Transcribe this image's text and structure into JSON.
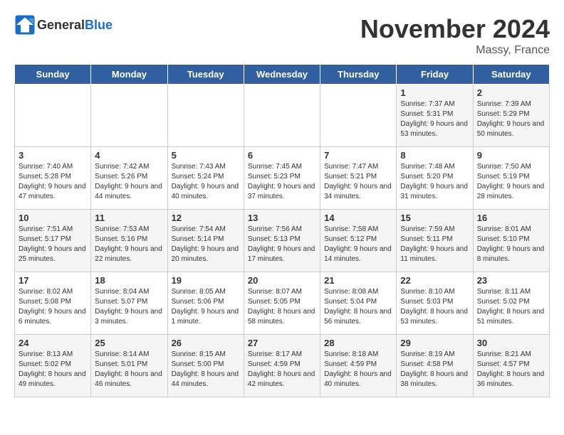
{
  "header": {
    "logo_general": "General",
    "logo_blue": "Blue",
    "title": "November 2024",
    "location": "Massy, France"
  },
  "days_of_week": [
    "Sunday",
    "Monday",
    "Tuesday",
    "Wednesday",
    "Thursday",
    "Friday",
    "Saturday"
  ],
  "weeks": [
    [
      {
        "day": "",
        "info": ""
      },
      {
        "day": "",
        "info": ""
      },
      {
        "day": "",
        "info": ""
      },
      {
        "day": "",
        "info": ""
      },
      {
        "day": "",
        "info": ""
      },
      {
        "day": "1",
        "info": "Sunrise: 7:37 AM\nSunset: 5:31 PM\nDaylight: 9 hours and 53 minutes."
      },
      {
        "day": "2",
        "info": "Sunrise: 7:39 AM\nSunset: 5:29 PM\nDaylight: 9 hours and 50 minutes."
      }
    ],
    [
      {
        "day": "3",
        "info": "Sunrise: 7:40 AM\nSunset: 5:28 PM\nDaylight: 9 hours and 47 minutes."
      },
      {
        "day": "4",
        "info": "Sunrise: 7:42 AM\nSunset: 5:26 PM\nDaylight: 9 hours and 44 minutes."
      },
      {
        "day": "5",
        "info": "Sunrise: 7:43 AM\nSunset: 5:24 PM\nDaylight: 9 hours and 40 minutes."
      },
      {
        "day": "6",
        "info": "Sunrise: 7:45 AM\nSunset: 5:23 PM\nDaylight: 9 hours and 37 minutes."
      },
      {
        "day": "7",
        "info": "Sunrise: 7:47 AM\nSunset: 5:21 PM\nDaylight: 9 hours and 34 minutes."
      },
      {
        "day": "8",
        "info": "Sunrise: 7:48 AM\nSunset: 5:20 PM\nDaylight: 9 hours and 31 minutes."
      },
      {
        "day": "9",
        "info": "Sunrise: 7:50 AM\nSunset: 5:19 PM\nDaylight: 9 hours and 28 minutes."
      }
    ],
    [
      {
        "day": "10",
        "info": "Sunrise: 7:51 AM\nSunset: 5:17 PM\nDaylight: 9 hours and 25 minutes."
      },
      {
        "day": "11",
        "info": "Sunrise: 7:53 AM\nSunset: 5:16 PM\nDaylight: 9 hours and 22 minutes."
      },
      {
        "day": "12",
        "info": "Sunrise: 7:54 AM\nSunset: 5:14 PM\nDaylight: 9 hours and 20 minutes."
      },
      {
        "day": "13",
        "info": "Sunrise: 7:56 AM\nSunset: 5:13 PM\nDaylight: 9 hours and 17 minutes."
      },
      {
        "day": "14",
        "info": "Sunrise: 7:58 AM\nSunset: 5:12 PM\nDaylight: 9 hours and 14 minutes."
      },
      {
        "day": "15",
        "info": "Sunrise: 7:59 AM\nSunset: 5:11 PM\nDaylight: 9 hours and 11 minutes."
      },
      {
        "day": "16",
        "info": "Sunrise: 8:01 AM\nSunset: 5:10 PM\nDaylight: 9 hours and 8 minutes."
      }
    ],
    [
      {
        "day": "17",
        "info": "Sunrise: 8:02 AM\nSunset: 5:08 PM\nDaylight: 9 hours and 6 minutes."
      },
      {
        "day": "18",
        "info": "Sunrise: 8:04 AM\nSunset: 5:07 PM\nDaylight: 9 hours and 3 minutes."
      },
      {
        "day": "19",
        "info": "Sunrise: 8:05 AM\nSunset: 5:06 PM\nDaylight: 9 hours and 1 minute."
      },
      {
        "day": "20",
        "info": "Sunrise: 8:07 AM\nSunset: 5:05 PM\nDaylight: 8 hours and 58 minutes."
      },
      {
        "day": "21",
        "info": "Sunrise: 8:08 AM\nSunset: 5:04 PM\nDaylight: 8 hours and 56 minutes."
      },
      {
        "day": "22",
        "info": "Sunrise: 8:10 AM\nSunset: 5:03 PM\nDaylight: 8 hours and 53 minutes."
      },
      {
        "day": "23",
        "info": "Sunrise: 8:11 AM\nSunset: 5:02 PM\nDaylight: 8 hours and 51 minutes."
      }
    ],
    [
      {
        "day": "24",
        "info": "Sunrise: 8:13 AM\nSunset: 5:02 PM\nDaylight: 8 hours and 49 minutes."
      },
      {
        "day": "25",
        "info": "Sunrise: 8:14 AM\nSunset: 5:01 PM\nDaylight: 8 hours and 46 minutes."
      },
      {
        "day": "26",
        "info": "Sunrise: 8:15 AM\nSunset: 5:00 PM\nDaylight: 8 hours and 44 minutes."
      },
      {
        "day": "27",
        "info": "Sunrise: 8:17 AM\nSunset: 4:59 PM\nDaylight: 8 hours and 42 minutes."
      },
      {
        "day": "28",
        "info": "Sunrise: 8:18 AM\nSunset: 4:59 PM\nDaylight: 8 hours and 40 minutes."
      },
      {
        "day": "29",
        "info": "Sunrise: 8:19 AM\nSunset: 4:58 PM\nDaylight: 8 hours and 38 minutes."
      },
      {
        "day": "30",
        "info": "Sunrise: 8:21 AM\nSunset: 4:57 PM\nDaylight: 8 hours and 36 minutes."
      }
    ]
  ]
}
